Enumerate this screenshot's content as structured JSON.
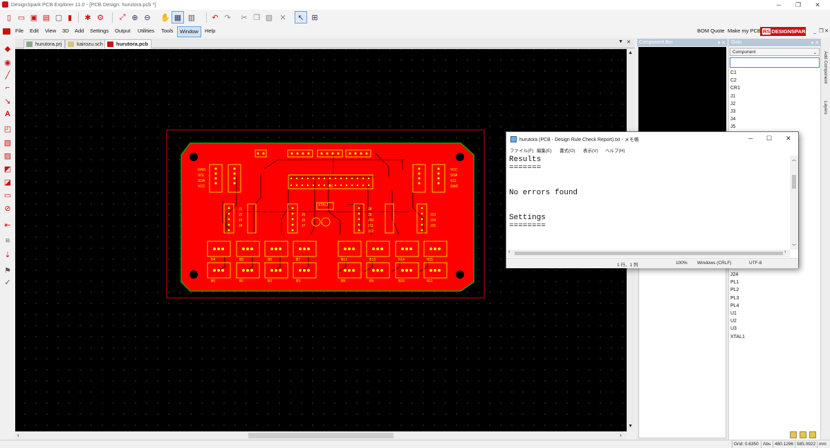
{
  "window": {
    "title": "DesignSpark PCB Explorer 11.0 - [PCB Design: hurutora.pcb *]",
    "minimize": "─",
    "restore": "❐",
    "close": "✕"
  },
  "menus": [
    "File",
    "Edit",
    "View",
    "3D",
    "Add",
    "Settings",
    "Output",
    "Utilities",
    "Tools",
    "Window",
    "Help"
  ],
  "active_menu": "Window",
  "header_links": {
    "bom_quote": "BOM Quote",
    "make_my_pcb": "Make my PCB",
    "brand": "DESIGNSPARK"
  },
  "tabs": [
    {
      "label": "hurutora.prj"
    },
    {
      "label": "kairozu.sch"
    },
    {
      "label": "hurutora.pcb"
    }
  ],
  "component_bin": {
    "title": "Component Bin"
  },
  "goto": {
    "title": "Goto",
    "filter_value": "Component",
    "search_value": "",
    "items": [
      "C1",
      "C2",
      "CR1",
      "J1",
      "J2",
      "J3",
      "J4",
      "J5"
    ],
    "items_below": [
      "J24",
      "PL1",
      "PL2",
      "PL3",
      "PL4",
      "U1",
      "U2",
      "U3",
      "XTAL1"
    ]
  },
  "side_tabs": {
    "add_component": "Add Component",
    "layers": "Layers"
  },
  "status": {
    "grid": "Grid: 0.6350",
    "abs": "Abs",
    "x": "480.1296",
    "y": "585.0922",
    "units": "mm"
  },
  "notepad": {
    "title": "hurutora (PCB - Design Rule Check Report).txt - メモ帳",
    "menus": [
      "ファイル(F)",
      "編集(E)",
      "書式(O)",
      "表示(V)",
      "ヘルプ(H)"
    ],
    "text": "Results\n=======\n\n\nNo errors found\n\n\nSettings\n========",
    "status_position": "1 行、1 列",
    "status_zoom": "100%",
    "status_eol": "Windows (CRLF)",
    "status_encoding": "UTF-8"
  },
  "pcb": {
    "left_labels": [
      "GND",
      "SCL",
      "SDA",
      "VCC"
    ],
    "right_labels": [
      "VCC",
      "SDA",
      "SCL",
      "GND"
    ],
    "chip_label": "U1",
    "crystal_label": "XTAL1",
    "row1": [
      "B4",
      "B5",
      "B6",
      "B7",
      "B12",
      "B13",
      "B14",
      "B15"
    ],
    "row2": [
      "B0",
      "B1",
      "B2",
      "B3",
      "B8",
      "B9",
      "B10",
      "B11"
    ],
    "connectors_left": [
      "J1",
      "J2",
      "J3",
      "J4"
    ],
    "connectors_mid": [
      "J5",
      "J6",
      "J7"
    ],
    "connectors_right": [
      "J8",
      "J9",
      "J10",
      "J11",
      "J12"
    ],
    "connectors_far": [
      "J13",
      "J14",
      "J15"
    ],
    "colors": {
      "board": "#ff0000",
      "outline": "#00b400",
      "silk": "#ffff00",
      "trace": "#8a0000"
    }
  }
}
